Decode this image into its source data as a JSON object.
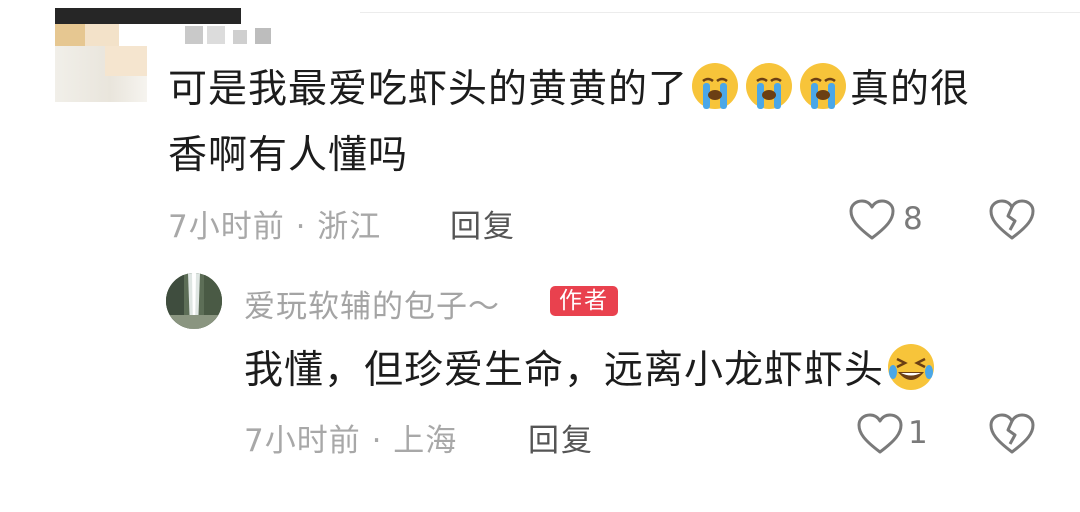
{
  "comment": {
    "text_part1": "可是我最爱吃虾头的黄黄的了",
    "emojis_inline": [
      "crying-emoji",
      "crying-emoji",
      "crying-emoji"
    ],
    "text_part2": "真的很",
    "text_line2": "香啊有人懂吗",
    "time_location": "7小时前 · 浙江",
    "reply_label": "回复",
    "like_count": "8"
  },
  "reply": {
    "username": "爱玩软辅的包子～",
    "author_badge": "作者",
    "text": "我懂，但珍爱生命，远离小龙虾虾头",
    "emoji": "laughing-crying-emoji",
    "time_location": "7小时前 · 上海",
    "reply_label": "回复",
    "like_count": "1"
  },
  "colors": {
    "badge": "#e9414e",
    "meta_text": "#a8a8a8",
    "body_text": "#1c1c1c"
  }
}
